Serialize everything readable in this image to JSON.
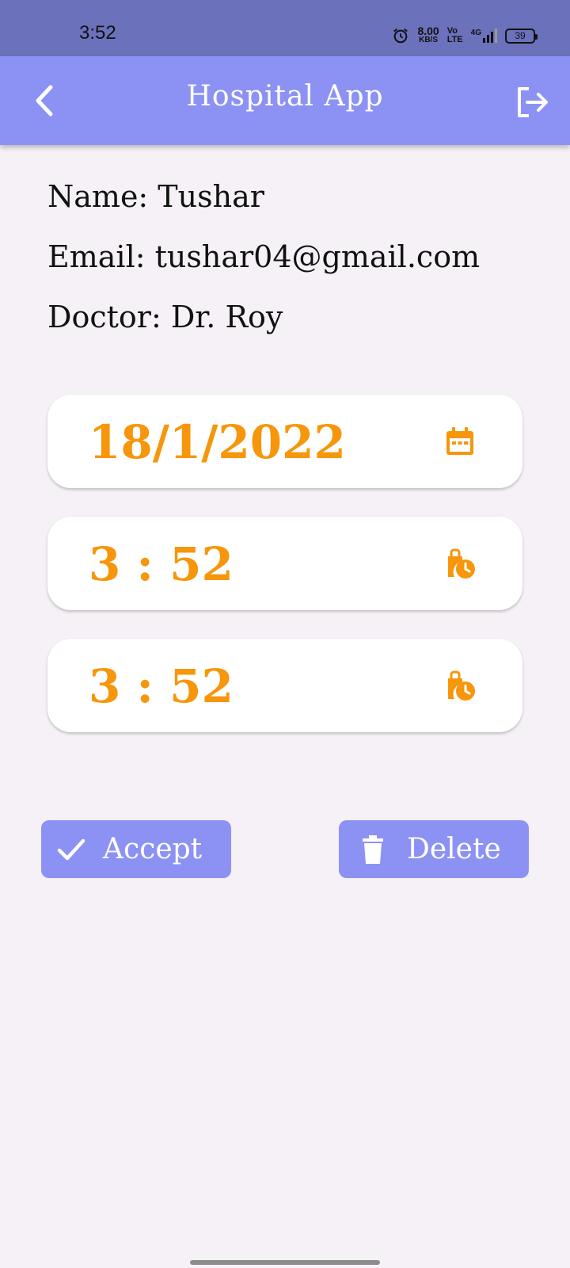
{
  "status_bar": {
    "time": "3:52",
    "net_speed_value": "8.00",
    "net_speed_unit": "KB/S",
    "volte_top": "Vo",
    "volte_bottom": "LTE",
    "network": "4G",
    "battery": "39"
  },
  "app_bar": {
    "title": "Hospital App",
    "back_icon": "chevron-left-icon",
    "logout_icon": "logout-icon",
    "color": "#8c92f4"
  },
  "patient": {
    "name_label": "Name: Tushar",
    "email_label": "Email: tushar04@gmail.com",
    "doctor_label": "Doctor: Dr. Roy"
  },
  "fields": {
    "date": {
      "value": "18/1/2022",
      "icon": "calendar-icon"
    },
    "start_time": {
      "value": "3 : 52",
      "icon": "clock-icon"
    },
    "end_time": {
      "value": "3 : 52",
      "icon": "clock-icon"
    },
    "accent_color": "#f7960b"
  },
  "actions": {
    "accept_label": "Accept",
    "accept_icon": "check-icon",
    "delete_label": "Delete",
    "delete_icon": "trash-icon"
  }
}
